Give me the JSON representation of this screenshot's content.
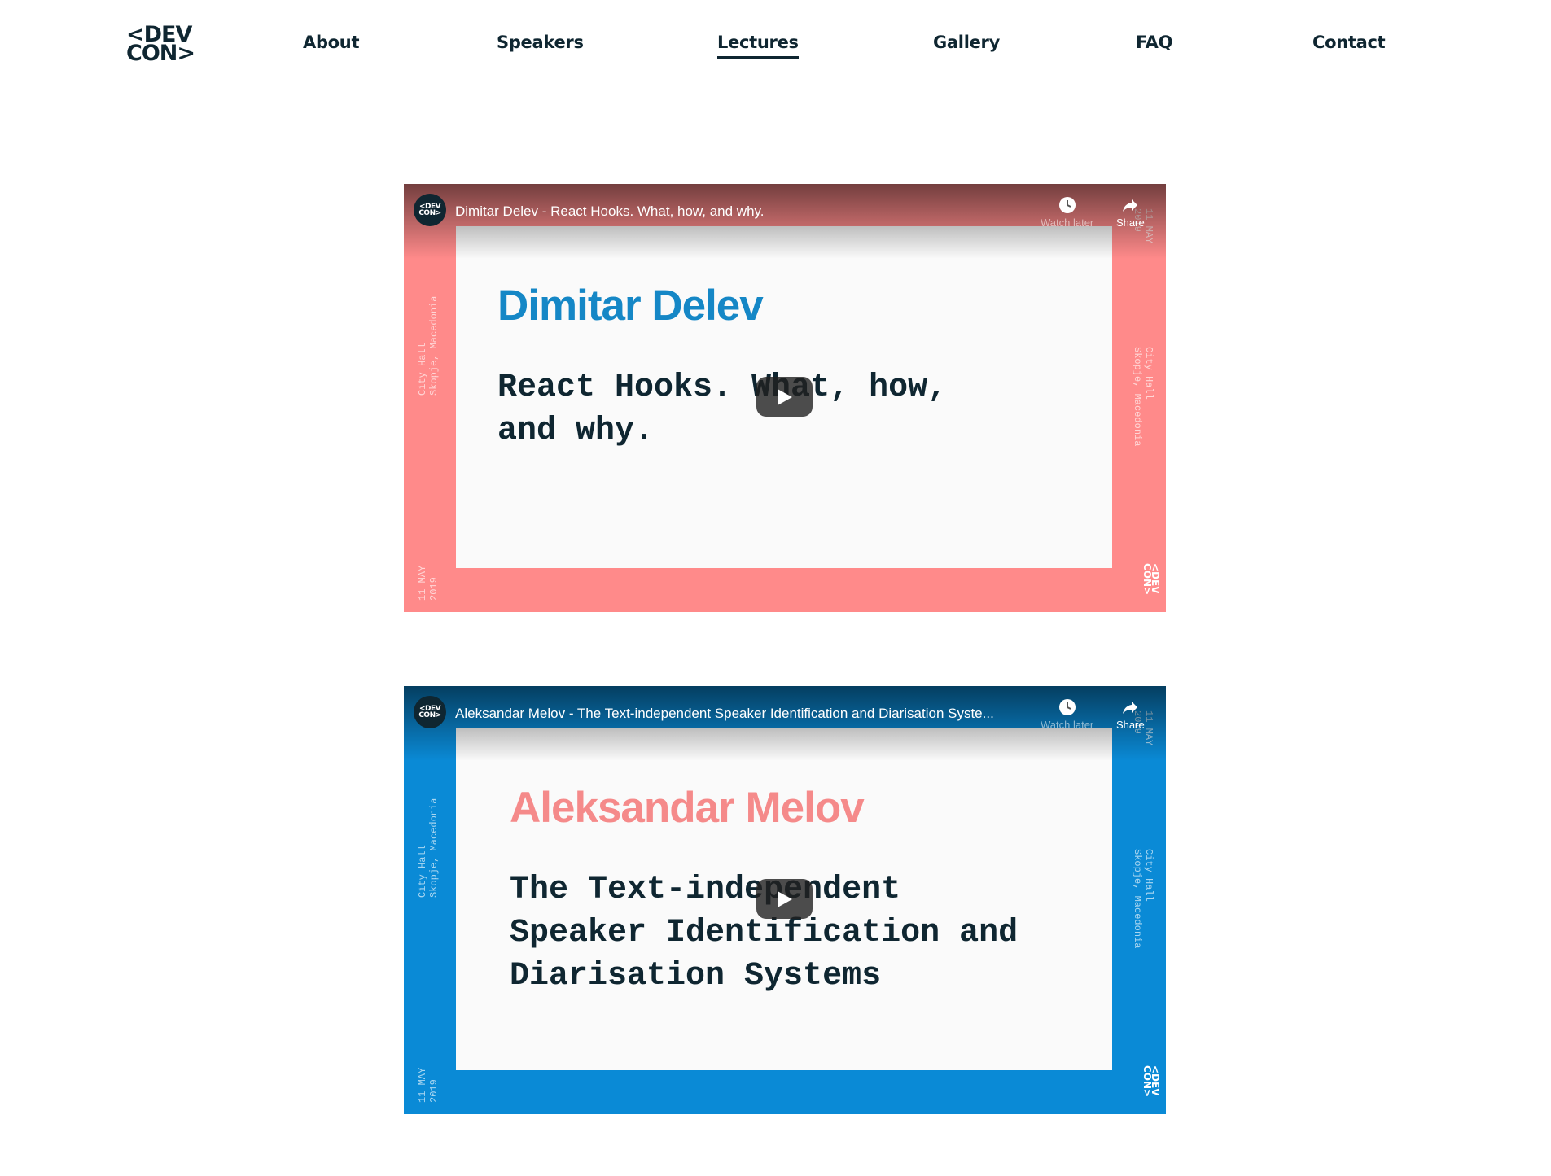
{
  "header": {
    "logo_line1": "<DEV",
    "logo_line2": "CON>",
    "nav": [
      {
        "label": "About"
      },
      {
        "label": "Speakers"
      },
      {
        "label": "Lectures",
        "active": true
      },
      {
        "label": "Gallery"
      },
      {
        "label": "FAQ"
      },
      {
        "label": "Contact"
      }
    ]
  },
  "videos": [
    {
      "title": "Dimitar Delev - React Hooks. What, how, and why.",
      "speaker": "Dimitar Delev",
      "talk": "React Hooks. What, how,\nand why.",
      "venue": "City Hall\nSkopje, Macedonia",
      "date": "11 MAY\n2019",
      "frame_color": "#ff8a8a",
      "speaker_color": "#1587c6",
      "watch_later_label": "Watch later",
      "share_label": "Share",
      "avatar_line1": "<DEV",
      "avatar_line2": "CON>"
    },
    {
      "title": "Aleksandar Melov - The Text-independent Speaker Identification and Diarisation Syste...",
      "speaker": "Aleksandar Melov",
      "talk": "The Text-independent\nSpeaker Identification and\nDiarisation Systems",
      "venue": "City Hall\nSkopje, Macedonia",
      "date": "11 MAY\n2019",
      "frame_color": "#0a8ad6",
      "speaker_color": "#f58a8a",
      "watch_later_label": "Watch later",
      "share_label": "Share",
      "avatar_line1": "<DEV",
      "avatar_line2": "CON>"
    }
  ],
  "icons": {
    "watch_later": "clock-icon",
    "share": "share-arrow-icon",
    "play": "play-icon"
  }
}
